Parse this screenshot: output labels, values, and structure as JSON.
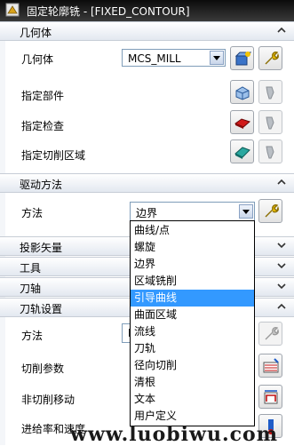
{
  "window": {
    "title": "固定轮廓铣 - [FIXED_CONTOUR]"
  },
  "sections": {
    "geometry": {
      "label": "几何体"
    },
    "drive_method": {
      "label": "驱动方法"
    },
    "projection_vector": {
      "label": "投影矢量"
    },
    "tool": {
      "label": "工具"
    },
    "tool_axis": {
      "label": "刀轴"
    },
    "toolpath_settings": {
      "label": "刀轨设置"
    }
  },
  "geometry": {
    "geometry_label": "几何体",
    "geometry_value": "MCS_MILL",
    "specify_part": "指定部件",
    "specify_check": "指定检查",
    "specify_cut_area": "指定切削区域"
  },
  "drive": {
    "method_label": "方法",
    "method_value": "边界",
    "options": [
      "曲线/点",
      "螺旋",
      "边界",
      "区域铣削",
      "引导曲线",
      "曲面区域",
      "流线",
      "刀轨",
      "径向切削",
      "清根",
      "文本",
      "用户定义"
    ],
    "highlighted_index": 4
  },
  "toolpath": {
    "method_label": "方法",
    "method_value": "M",
    "cut_params": "切削参数",
    "non_cut_moves": "非切削移动",
    "feeds_speeds": "进给率和速度"
  },
  "watermark": {
    "text": "www.luobiwu.com"
  },
  "colors": {
    "highlight": "#3399ff",
    "titlebar": "#1e1e1e"
  }
}
